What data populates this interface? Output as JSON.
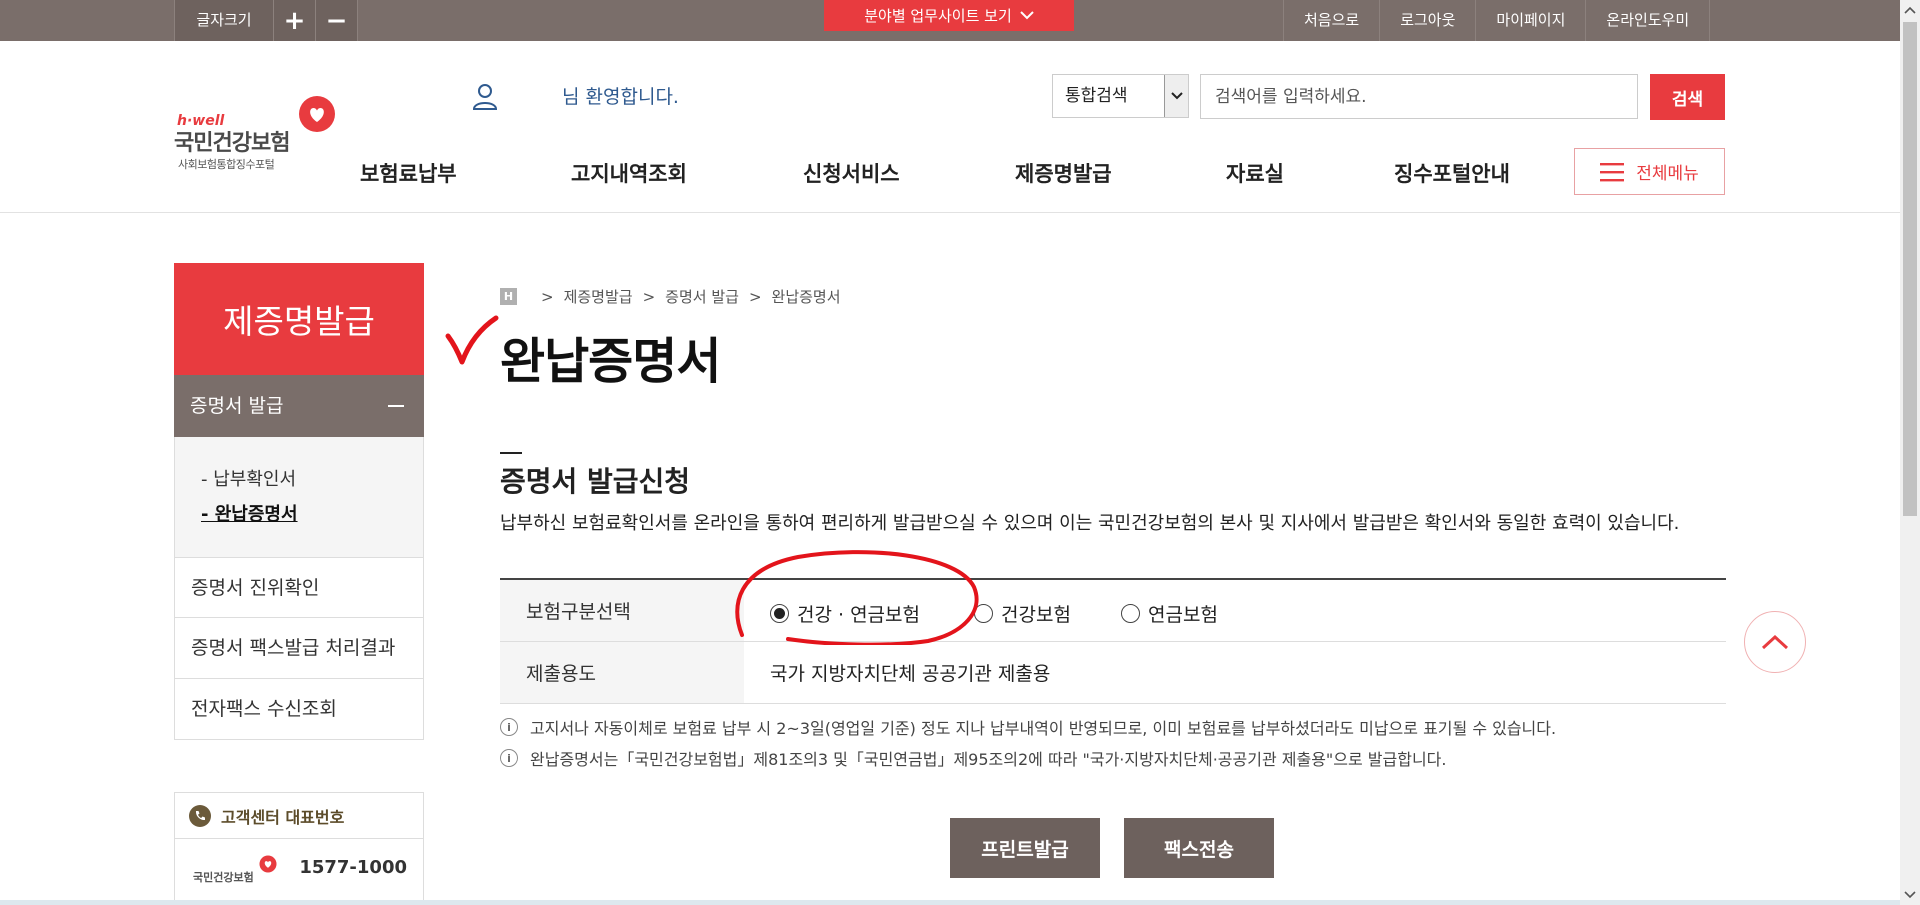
{
  "topbar": {
    "font_size_label": "글자크기",
    "plus": "+",
    "minus": "−",
    "field_site_label": "분야별 업무사이트 보기",
    "links": [
      "처음으로",
      "로그아웃",
      "마이페이지",
      "온라인도우미"
    ]
  },
  "logo": {
    "hwell": "h·well",
    "name": "국민건강보험",
    "sub": "사회보험통합징수포털"
  },
  "header": {
    "welcome": "님 환영합니다.",
    "search_select": "통합검색",
    "search_placeholder": "검색어를 입력하세요.",
    "search_button": "검색",
    "gnb": [
      "보험료납부",
      "고지내역조회",
      "신청서비스",
      "제증명발급",
      "자료실",
      "징수포털안내"
    ],
    "all_menu": "전체메뉴"
  },
  "lnb": {
    "title": "제증명발급",
    "group": "증명서 발급",
    "sub_items": [
      "- 납부확인서",
      "- 완납증명서"
    ],
    "items": [
      "증명서 진위확인",
      "증명서 팩스발급 처리결과",
      "전자팩스 수신조회"
    ],
    "cs_title": "고객센터 대표번호",
    "cs_logo": "국민건강보험",
    "cs_number": "1577-1000"
  },
  "content": {
    "breadcrumb": [
      "제증명발급",
      "증명서 발급",
      "완납증명서"
    ],
    "breadcrumb_home": "H",
    "page_title": "완납증명서",
    "section_title": "증명서 발급신청",
    "section_desc": "납부하신 보험료확인서를 온라인을 통하여 편리하게 발급받으실 수 있으며 이는 국민건강보험의 본사 및 지사에서 발급받은 확인서와 동일한 효력이 있습니다.",
    "row1_label": "보험구분선택",
    "radio_options": [
      "건강 · 연금보험",
      "건강보험",
      "연금보험"
    ],
    "radio_selected": "건강 · 연금보험",
    "row2_label": "제출용도",
    "row2_value": "국가 지방자치단체 공공기관 제출용",
    "notices": [
      "고지서나 자동이체로 보험료 납부 시 2~3일(영업일 기준) 정도 지나 납부내역이 반영되므로, 이미 보험료를 납부하셨더라도 미납으로 표기될 수 있습니다.",
      "완납증명서는「국민건강보험법」제81조의3 및「국민연금법」제95조의2에 따라 \"국가·지방자치단체·공공기관 제출용\"으로 발급합니다."
    ],
    "print_button": "프린트발급",
    "fax_button": "팩스전송"
  },
  "colors": {
    "brand_red": "#e83b3f",
    "brown_gray": "#7a6e6a",
    "annotation_red": "#e3141b"
  }
}
